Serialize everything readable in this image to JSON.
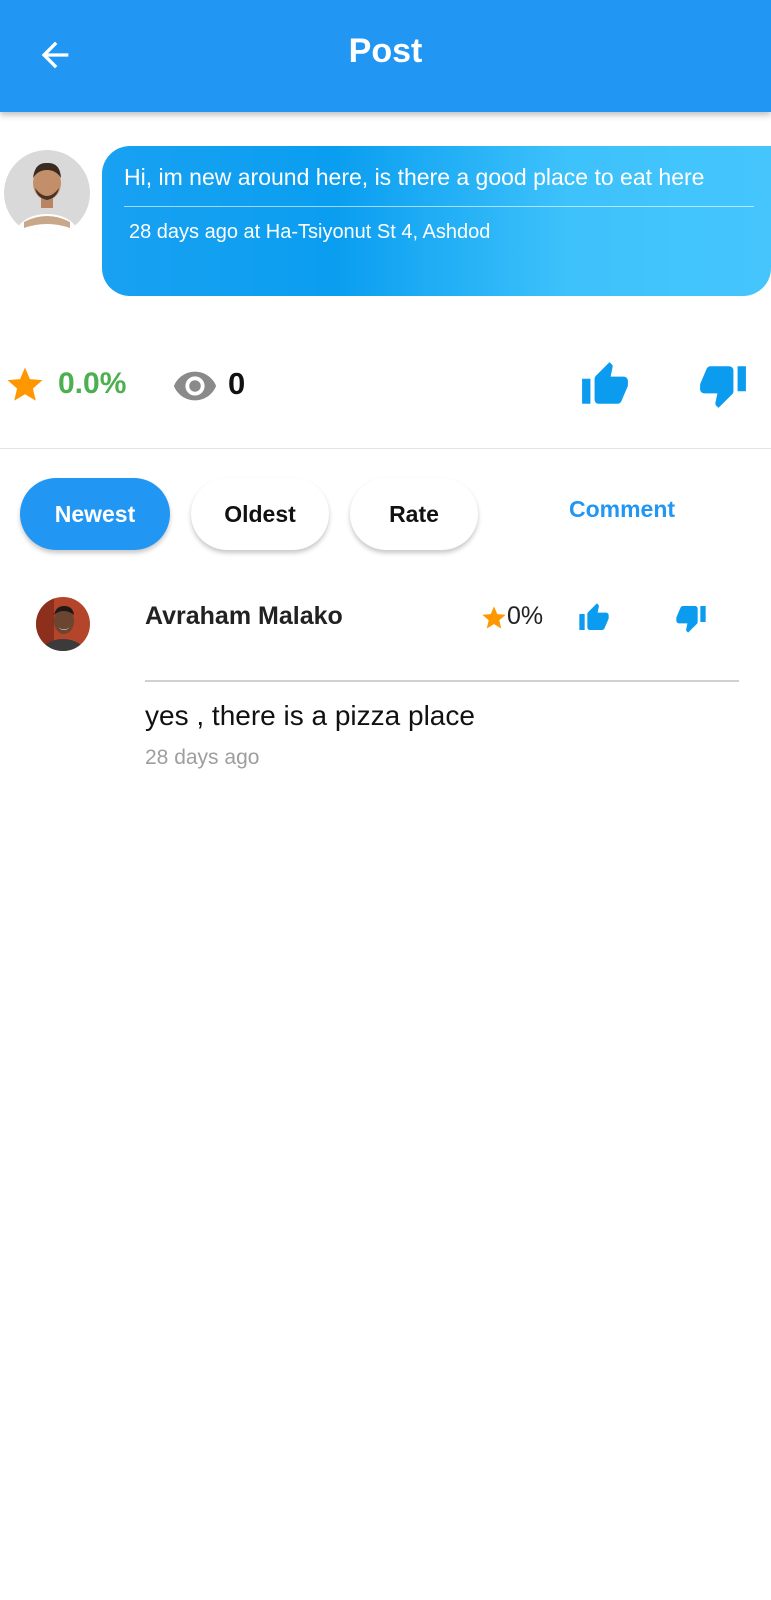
{
  "app_bar": {
    "title": "Post",
    "back_icon": "arrow-back-icon",
    "color": "#2196F3"
  },
  "post": {
    "text": "Hi, im new around here, is there a good place to eat here",
    "meta": "28 days ago at Ha-Tsiyonut St 4, Ashdod",
    "avatar": "avatar-icon"
  },
  "stats": {
    "rating": "0.0%",
    "views": "0",
    "rating_color": "#4CAF50",
    "accent_color": "#0b9cf0",
    "star_color": "#FF9800"
  },
  "sort": {
    "newest": "Newest",
    "oldest": "Oldest",
    "rate": "Rate",
    "selected": "Newest"
  },
  "comment_button": "Comment",
  "comments": [
    {
      "author": "Avraham Malako",
      "rating": "0%",
      "text": "yes , there is a pizza place",
      "time": "28 days ago"
    }
  ]
}
